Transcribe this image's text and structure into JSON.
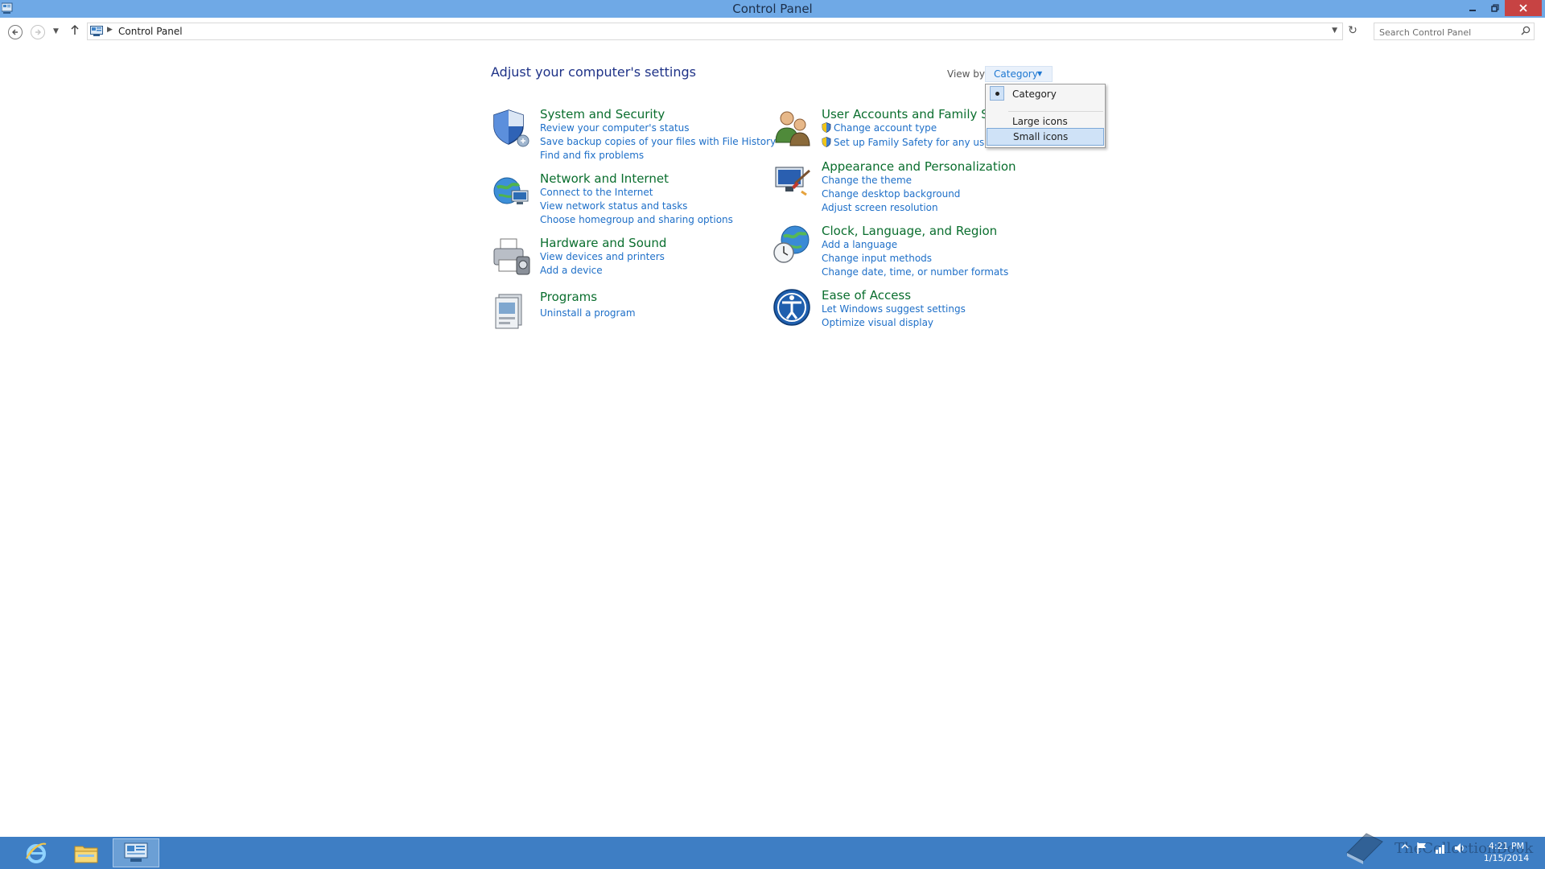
{
  "window": {
    "title": "Control Panel"
  },
  "navbar": {
    "breadcrumb": "Control Panel",
    "search_placeholder": "Search Control Panel"
  },
  "main": {
    "heading": "Adjust your computer's settings",
    "view_by_label": "View by:",
    "view_by_value": "Category",
    "categories": [
      {
        "title": "System and Security",
        "icon": "shield-icon",
        "links": [
          "Review your computer's status",
          "Save backup copies of your files with File History",
          "Find and fix problems"
        ]
      },
      {
        "title": "Network and Internet",
        "icon": "network-globe-icon",
        "links": [
          "Connect to the Internet",
          "View network status and tasks",
          "Choose homegroup and sharing options"
        ]
      },
      {
        "title": "Hardware and Sound",
        "icon": "printer-icon",
        "links": [
          "View devices and printers",
          "Add a device"
        ]
      },
      {
        "title": "Programs",
        "icon": "programs-icon",
        "links": [
          "Uninstall a program"
        ]
      },
      {
        "title": "User Accounts and Family Safety",
        "icon": "users-icon",
        "links": [
          "Change account type",
          "Set up Family Safety for any user"
        ]
      },
      {
        "title": "Appearance and Personalization",
        "icon": "monitor-brush-icon",
        "links": [
          "Change the theme",
          "Change desktop background",
          "Adjust screen resolution"
        ]
      },
      {
        "title": "Clock, Language, and Region",
        "icon": "clock-globe-icon",
        "links": [
          "Add a language",
          "Change input methods",
          "Change date, time, or number formats"
        ]
      },
      {
        "title": "Ease of Access",
        "icon": "ease-of-access-icon",
        "links": [
          "Let Windows suggest settings",
          "Optimize visual display"
        ]
      }
    ]
  },
  "view_dropdown": {
    "options": [
      "Category",
      "Large icons",
      "Small icons"
    ],
    "selected": "Category",
    "hovered": "Small icons"
  },
  "taskbar": {
    "apps": [
      "internet-explorer-icon",
      "file-explorer-icon",
      "control-panel-icon"
    ],
    "time": "4:21 PM",
    "date": "1/15/2014"
  },
  "watermark": {
    "text": "TheCollectionBook"
  },
  "colors": {
    "titlebar": "#6fa9e6",
    "close_button": "#c74343",
    "category_title": "#0a6e2e",
    "link": "#1e6fc8",
    "heading": "#1e3287",
    "taskbar": "#3e7ec4"
  }
}
